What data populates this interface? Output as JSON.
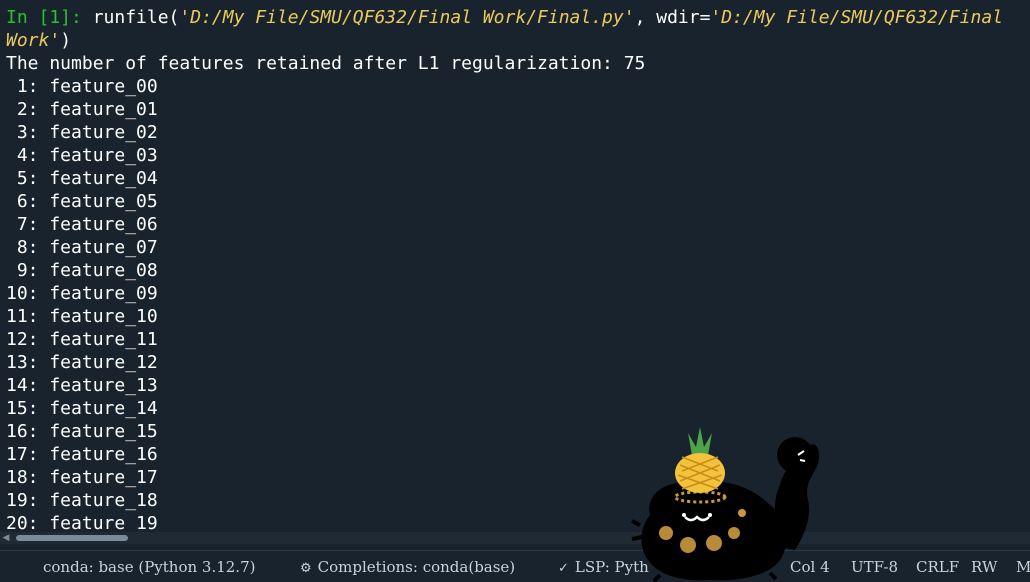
{
  "console": {
    "prompt": "In [1]:",
    "command_fn": "runfile(",
    "command_path": "'D:/My File/SMU/QF632/Final Work/Final.py'",
    "command_sep": ", wdir=",
    "command_wdir_part1": "'D:/My File/SMU/QF632/Final",
    "command_wdir_part2": "Work'",
    "command_close": ")",
    "summary": "The number of features retained after L1 regularization: 75",
    "features": [
      " 1: feature_00",
      " 2: feature_01",
      " 3: feature_02",
      " 4: feature_03",
      " 5: feature_04",
      " 6: feature_05",
      " 7: feature_06",
      " 8: feature_07",
      " 9: feature_08",
      "10: feature_09",
      "11: feature_10",
      "12: feature_11",
      "13: feature_12",
      "14: feature_13",
      "15: feature_14",
      "16: feature_15",
      "17: feature_16",
      "18: feature_17",
      "19: feature_18",
      "20: feature_19"
    ]
  },
  "statusbar": {
    "conda": "conda: base (Python 3.12.7)",
    "completions": "Completions: conda(base)",
    "completions_icon": "completions-icon",
    "lsp": "LSP: Pyth",
    "lsp_icon": "check-icon",
    "col": "Col 4",
    "encoding": "UTF-8",
    "eol": "CRLF",
    "rw": "RW",
    "mem": "Me"
  },
  "colors": {
    "background": "#19232d",
    "prompt": "#29c12e",
    "string": "#eaca5c",
    "text": "#ffffff"
  }
}
